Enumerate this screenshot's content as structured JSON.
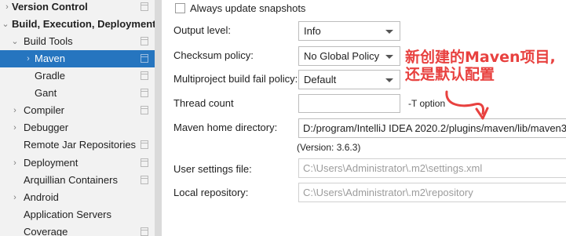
{
  "sidebar": {
    "items": [
      {
        "label": "Version Control",
        "arrow": "›",
        "bold": true,
        "proj": true
      },
      {
        "label": "Build, Execution, Deployment",
        "arrow": "⌄",
        "bold": true,
        "proj": false
      },
      {
        "label": "Build Tools",
        "arrow": "⌄",
        "bold": false,
        "proj": true
      },
      {
        "label": "Maven",
        "arrow": "›",
        "bold": false,
        "proj": true,
        "selected": true
      },
      {
        "label": "Gradle",
        "arrow": "",
        "bold": false,
        "proj": true
      },
      {
        "label": "Gant",
        "arrow": "",
        "bold": false,
        "proj": true
      },
      {
        "label": "Compiler",
        "arrow": "›",
        "bold": false,
        "proj": true
      },
      {
        "label": "Debugger",
        "arrow": "›",
        "bold": false,
        "proj": false
      },
      {
        "label": "Remote Jar Repositories",
        "arrow": "",
        "bold": false,
        "proj": true
      },
      {
        "label": "Deployment",
        "arrow": "›",
        "bold": false,
        "proj": true
      },
      {
        "label": "Arquillian Containers",
        "arrow": "",
        "bold": false,
        "proj": true
      },
      {
        "label": "Android",
        "arrow": "›",
        "bold": false,
        "proj": false
      },
      {
        "label": "Application Servers",
        "arrow": "",
        "bold": false,
        "proj": false
      },
      {
        "label": "Coverage",
        "arrow": "",
        "bold": false,
        "proj": true
      }
    ]
  },
  "settings": {
    "always_update_label": "Always update snapshots",
    "always_update_checked": false,
    "output_level_label": "Output level:",
    "output_level_value": "Info",
    "checksum_label": "Checksum policy:",
    "checksum_value": "No Global Policy",
    "multiproject_label": "Multiproject build fail policy:",
    "multiproject_value": "Default",
    "thread_count_label": "Thread count",
    "thread_count_value": "",
    "thread_hint": "-T option",
    "maven_home_label": "Maven home directory:",
    "maven_home_value": "D:/program/IntelliJ IDEA 2020.2/plugins/maven/lib/maven3",
    "maven_version": "(Version: 3.6.3)",
    "user_settings_label": "User settings file:",
    "user_settings_value": "C:\\Users\\Administrator\\.m2\\settings.xml",
    "local_repo_label": "Local repository:",
    "local_repo_value": "C:\\Users\\Administrator\\.m2\\repository"
  },
  "annotation": {
    "line1": "新创建的Maven项目,",
    "line2": "还是默认配置",
    "color": "#e8413f"
  },
  "colors": {
    "selection": "#2675bf",
    "sidebar_bg": "#f2f2f2"
  }
}
